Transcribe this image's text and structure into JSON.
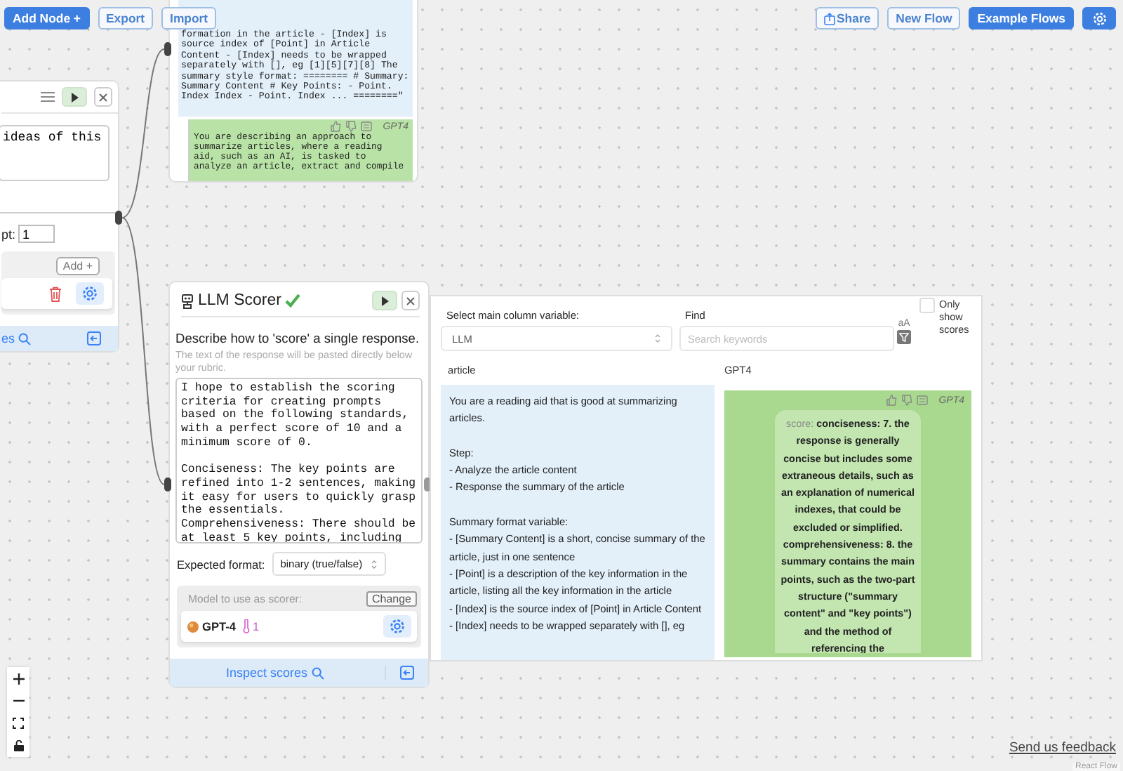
{
  "toolbar_left": [
    {
      "kind": "primary",
      "label": "Add Node +"
    },
    {
      "kind": "outline",
      "label": "Export"
    },
    {
      "kind": "outline",
      "label": "Import"
    }
  ],
  "toolbar_right": [
    {
      "kind": "share",
      "label": "Share"
    },
    {
      "kind": "outline",
      "label": "New Flow"
    },
    {
      "kind": "primary",
      "label": "Example Flows"
    },
    {
      "kind": "settings"
    }
  ],
  "prompt_node": {
    "prompt_text": "ideas of this",
    "count_label": "pt:",
    "count_value": "1",
    "add_button": "Add +",
    "footer_link": "es"
  },
  "response_node": {
    "prompt_text": "formation in the article - [Index] is source index of [Point] in Article Content - [Index] needs to be wrapped separately with [], eg [1][5][7][8] The summary style format: ======== # Summary: Summary Content # Key Points: - Point. Index Index - Point. Index ... ========\"",
    "response": {
      "model": "GPT4",
      "text": "You are describing an approach to summarize articles, where a reading aid, such as an AI, is tasked to analyze an article, extract and compile"
    }
  },
  "scorer_node": {
    "title": "LLM Scorer",
    "heading": "Describe how to 'score' a single response.",
    "hint": "The text of the response will be pasted directly below your rubric.",
    "rubric": "I hope to establish the scoring criteria for creating prompts based on the following standards, with a perfect score of 10 and a minimum score of 0.\n\nConciseness: The key points are refined into 1-2 sentences, making it easy for users to quickly grasp the essentials.\nComprehensiveness: There should be at least 5 key points, including",
    "format_label": "Expected format:",
    "format_value": "binary (true/false)",
    "model_label": "Model to use as scorer:",
    "change_button": "Change",
    "model_name": "GPT-4",
    "model_count": "1",
    "footer_link": "Inspect scores"
  },
  "inspector": {
    "column_label": "Select main column variable:",
    "column_value": "LLM",
    "find_label": "Find",
    "search_placeholder": "Search keywords",
    "match_case": "aA",
    "only_show_scores": false,
    "only_show_scores_label": "Only show scores",
    "columns": [
      "article",
      "GPT4"
    ],
    "article_text": "You are a reading aid that is good at summarizing articles.\n\nStep:\n- Analyze the article content\n- Response the summary of the article\n\nSummary format variable:\n- [Summary Content] is a short, concise summary of the article, just in one sentence\n- [Point] is a description of the key information in the article, listing all the key information in the article\n- [Index] is the source index of [Point] in Article Content\n- [Index] needs to be wrapped separately with [], eg",
    "response_model": "GPT4",
    "score_label": "score:",
    "score_text": "conciseness: 7. the response is generally concise but includes some extraneous details, such as an explanation of numerical indexes, that could be excluded or simplified. comprehensiveness: 8. the summary contains the main points, such as the two-part structure (\"summary content\" and \"key points\") and the method of referencing the"
  },
  "feedback_link": "Send us feedback",
  "attribution": "React Flow"
}
